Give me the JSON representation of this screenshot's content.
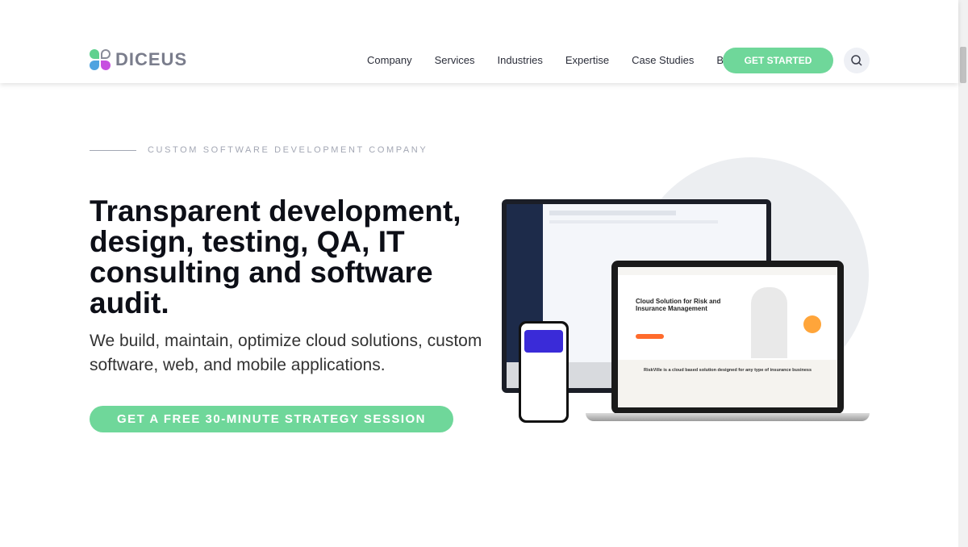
{
  "header": {
    "logo_text": "DICEUS",
    "nav": [
      "Company",
      "Services",
      "Industries",
      "Expertise",
      "Case Studies",
      "Blog"
    ],
    "cta_label": "GET STARTED",
    "icons": {
      "search": "search-icon"
    }
  },
  "hero": {
    "eyebrow": "CUSTOM SOFTWARE DEVELOPMENT COMPANY",
    "title": "Transparent development, design, testing, QA, IT consulting and software audit.",
    "subtitle": "We build, maintain, optimize cloud solutions, custom software, web, and mobile applications.",
    "cta_label": "GET A FREE 30-MINUTE STRATEGY SESSION"
  },
  "mockup": {
    "laptop_title": "Cloud Solution for Risk and Insurance Management",
    "laptop_band": "RiskVille is a cloud based solution designed for any type of insurance business"
  },
  "colors": {
    "accent": "#6fd79a",
    "text": "#0d0f17",
    "orange": "#ff6b2c"
  }
}
